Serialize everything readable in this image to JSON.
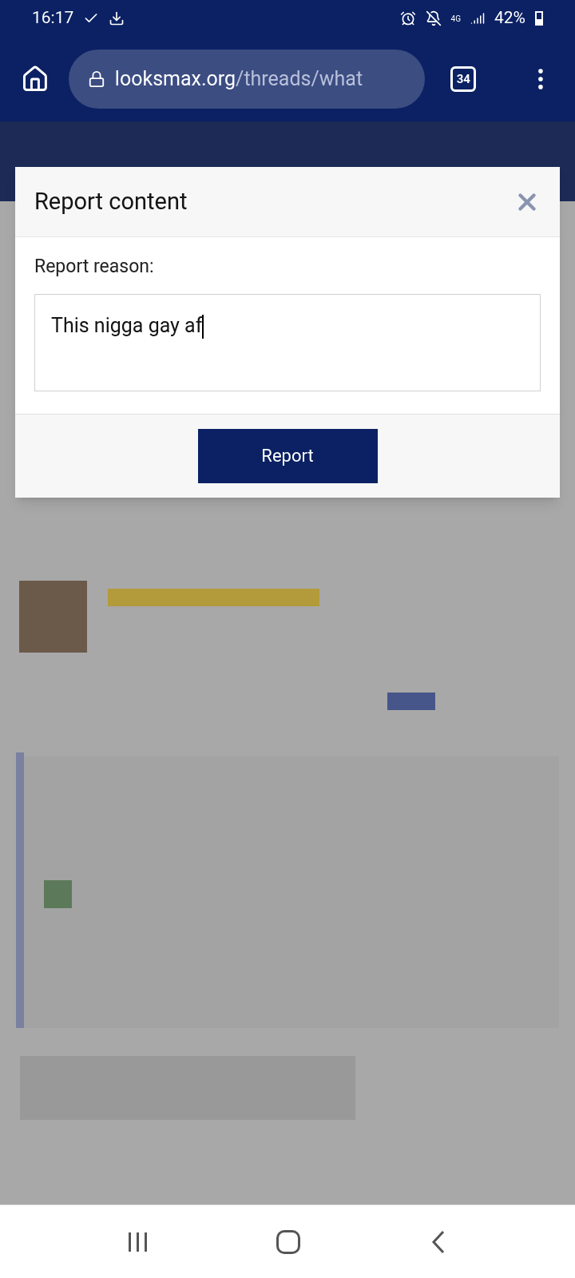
{
  "status_bar": {
    "time": "16:17",
    "network": "4G",
    "battery": "42%"
  },
  "browser": {
    "url_host": "looksmax.org",
    "url_path": "/threads/what",
    "tab_count": "34"
  },
  "dialog": {
    "title": "Report content",
    "field_label": "Report reason:",
    "field_value": "This nigga gay af",
    "button": "Report"
  }
}
